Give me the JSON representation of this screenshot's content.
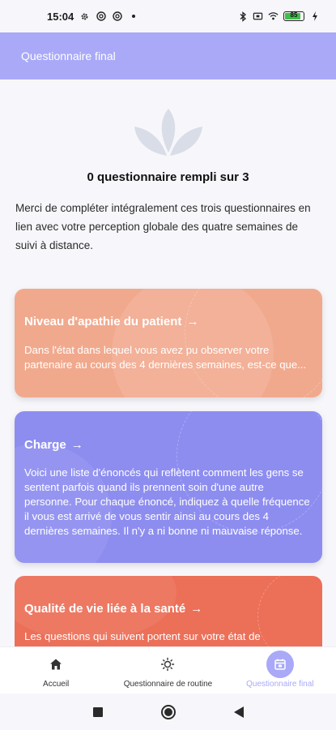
{
  "status_bar": {
    "time": "15:04",
    "battery_level": "85",
    "icons": [
      "gear-icon",
      "at-icon",
      "at-icon",
      "dot-icon",
      "bluetooth-icon",
      "vibrate-icon",
      "wifi-icon",
      "battery-icon",
      "charging-icon"
    ]
  },
  "header": {
    "title": "Questionnaire final"
  },
  "progress": {
    "text": "0 questionnaire rempli sur 3",
    "completed": 0,
    "total": 3
  },
  "intro": "Merci de compléter intégralement ces trois questionnaires en lien avec votre perception globale des quatre semaines de suivi à distance.",
  "cards": [
    {
      "title": "Niveau d'apathie du patient",
      "arrow": "→",
      "description": "Dans l'état dans lequel vous avez pu observer votre partenaire au cours des 4 dernières semaines, est-ce que...",
      "color": "#f1a98d"
    },
    {
      "title": "Charge",
      "arrow": "→",
      "description": "Voici une liste d'énoncés qui reflètent comment les gens se sentent parfois quand ils prennent soin d'une autre personne. Pour chaque énoncé, indiquez à quelle fréquence il vous est arrivé de vous sentir ainsi au cours des 4 dernières semaines. Il n'y a ni bonne ni mauvaise réponse.",
      "color": "#8d8df0"
    },
    {
      "title": "Qualité de vie liée à la santé",
      "arrow": "→",
      "description": "Les questions qui suivent portent sur votre état de",
      "color": "#ec6f58"
    }
  ],
  "bottom_nav": [
    {
      "label": "Accueil",
      "icon": "home-icon",
      "active": false
    },
    {
      "label": "Questionnaire de routine",
      "icon": "sun-icon",
      "active": false
    },
    {
      "label": "Questionnaire final",
      "icon": "calendar-icon",
      "active": true
    }
  ],
  "colors": {
    "accent": "#a9a9f8",
    "background": "#f7f7fb"
  }
}
